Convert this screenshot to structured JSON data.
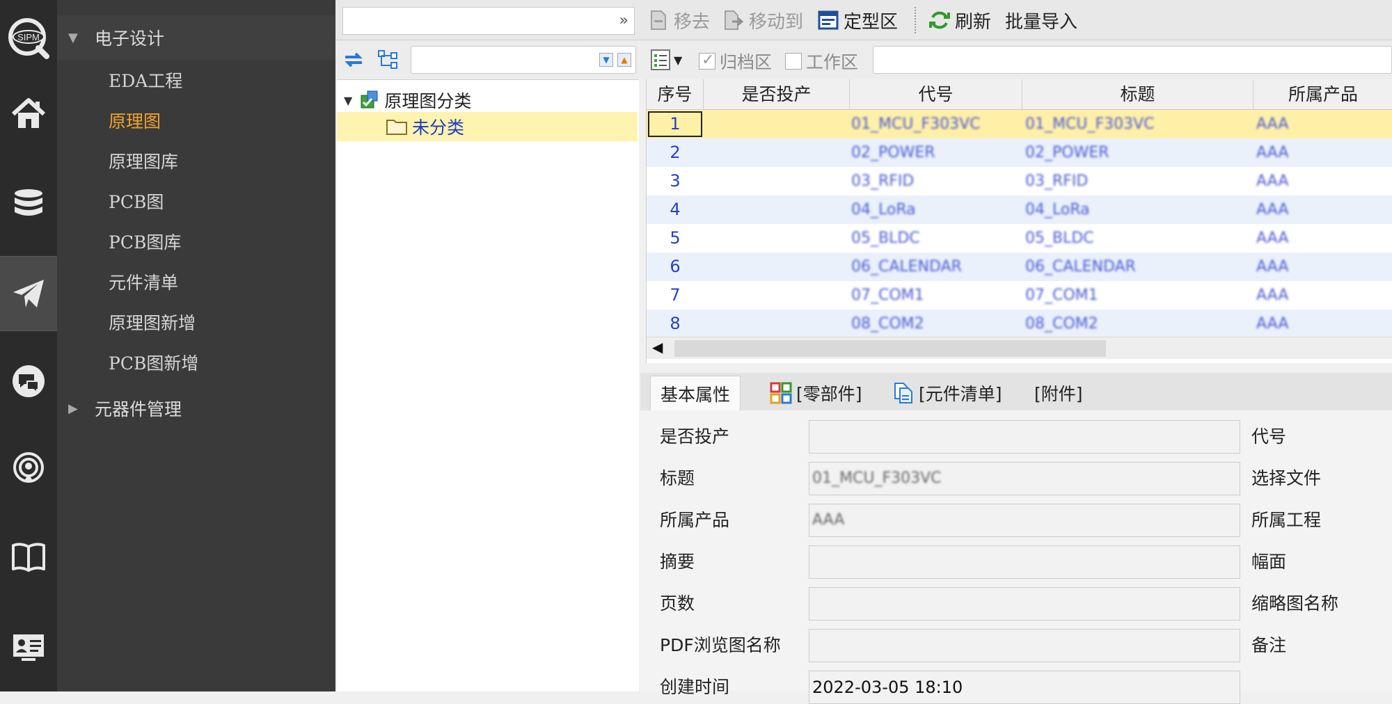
{
  "colors": {
    "rail_bg": "#2b2b2b",
    "menu_bg": "#3a3a3a",
    "active_nav": "#f2a22c",
    "selected_row": "#fff0a8",
    "alt_row": "#eaf1fb",
    "link_blue": "#1a3fbf"
  },
  "rail": [
    {
      "icon": "sipm-logo-icon",
      "label": "SIPM"
    },
    {
      "icon": "home-icon"
    },
    {
      "icon": "database-icon"
    },
    {
      "icon": "paper-plane-icon"
    },
    {
      "icon": "chat-icon"
    },
    {
      "icon": "podcast-icon"
    },
    {
      "icon": "book-icon"
    },
    {
      "icon": "id-card-icon"
    }
  ],
  "nav": {
    "group1": "电子设计",
    "items": [
      "EDA工程",
      "原理图",
      "原理图库",
      "PCB图",
      "PCB图库",
      "元件清单",
      "原理图新增",
      "PCB图新增"
    ],
    "active_index": 1,
    "group2": "元器件管理"
  },
  "toolbar": {
    "move_out": "移去",
    "move_to": "移动到",
    "finalize_zone": "定型区",
    "refresh": "刷新",
    "batch_import": "批量导入"
  },
  "tree": {
    "root": "原理图分类",
    "child": "未分类"
  },
  "grid_toolbar": {
    "archive": "归档区",
    "workspace": "工作区"
  },
  "grid": {
    "columns": [
      "序号",
      "是否投产",
      "代号",
      "标题",
      "所属产品"
    ],
    "rows": [
      {
        "seq": "1",
        "produced": "",
        "code": "01_MCU_F303VC",
        "title": "01_MCU_F303VC",
        "product": "AAA"
      },
      {
        "seq": "2",
        "produced": "",
        "code": "02_POWER",
        "title": "02_POWER",
        "product": "AAA"
      },
      {
        "seq": "3",
        "produced": "",
        "code": "03_RFID",
        "title": "03_RFID",
        "product": "AAA"
      },
      {
        "seq": "4",
        "produced": "",
        "code": "04_LoRa",
        "title": "04_LoRa",
        "product": "AAA"
      },
      {
        "seq": "5",
        "produced": "",
        "code": "05_BLDC",
        "title": "05_BLDC",
        "product": "AAA"
      },
      {
        "seq": "6",
        "produced": "",
        "code": "06_CALENDAR",
        "title": "06_CALENDAR",
        "product": "AAA"
      },
      {
        "seq": "7",
        "produced": "",
        "code": "07_COM1",
        "title": "07_COM1",
        "product": "AAA"
      },
      {
        "seq": "8",
        "produced": "",
        "code": "08_COM2",
        "title": "08_COM2",
        "product": "AAA"
      }
    ]
  },
  "tabs": [
    "基本属性",
    "[零部件]",
    "[元件清单]",
    "[附件]"
  ],
  "form": {
    "left": [
      {
        "label": "是否投产",
        "value": ""
      },
      {
        "label": "标题",
        "value": "01_MCU_F303VC"
      },
      {
        "label": "所属产品",
        "value": "AAA"
      },
      {
        "label": "摘要",
        "value": ""
      },
      {
        "label": "页数",
        "value": ""
      },
      {
        "label": "PDF浏览图名称",
        "value": ""
      },
      {
        "label": "创建时间",
        "value": "2022-03-05 18:10"
      }
    ],
    "right": [
      "代号",
      "选择文件",
      "所属工程",
      "幅面",
      "缩略图名称",
      "备注"
    ]
  }
}
